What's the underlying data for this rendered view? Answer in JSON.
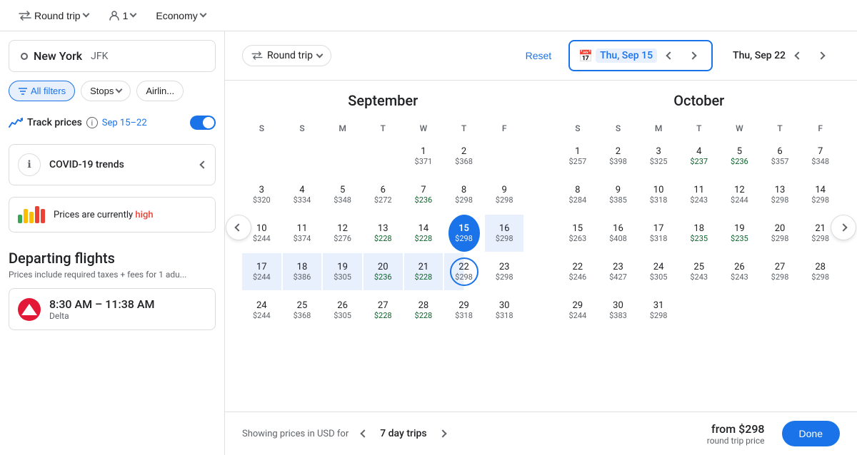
{
  "topbar": {
    "round_trip": "Round trip",
    "passengers": "1",
    "cabin": "Economy"
  },
  "sidebar": {
    "origin": "New York",
    "origin_code": "JFK",
    "filters": {
      "all_filters": "All filters",
      "stops": "Stops",
      "airlines": "Airlin..."
    },
    "track_prices": {
      "label": "Track prices",
      "date_range": "Sep 15–22"
    },
    "covid": {
      "label": "COVID-19 trends"
    },
    "prices_currently": {
      "label": "Prices are currently",
      "status": "high"
    },
    "departing": {
      "title": "Departing flights",
      "subtitle": "Prices include required taxes + fees for 1 adu...",
      "flight_time": "8:30 AM – 11:38 AM",
      "airline": "Delta"
    }
  },
  "calendar": {
    "header": {
      "round_trip": "Round trip",
      "reset": "Reset",
      "selected_date": "Thu, Sep 15",
      "return_date": "Thu, Sep 22"
    },
    "footer": {
      "showing_label": "Showing prices in USD for",
      "trips_duration": "7 day trips",
      "from_price": "from $298",
      "round_trip_price": "round trip price",
      "done": "Done"
    },
    "september": {
      "title": "September",
      "days_header": [
        "S",
        "S",
        "M",
        "T",
        "W",
        "T",
        "F"
      ],
      "weeks": [
        [
          {
            "num": "",
            "price": ""
          },
          {
            "num": "",
            "price": ""
          },
          {
            "num": "",
            "price": ""
          },
          {
            "num": "",
            "price": ""
          },
          {
            "num": "1",
            "price": "$371"
          },
          {
            "num": "2",
            "price": "$368"
          },
          {
            "num": "",
            "price": ""
          }
        ],
        [
          {
            "num": "3",
            "price": "$320"
          },
          {
            "num": "4",
            "price": "$334"
          },
          {
            "num": "5",
            "price": "$348"
          },
          {
            "num": "6",
            "price": "$272"
          },
          {
            "num": "7",
            "price": "$236",
            "green": true
          },
          {
            "num": "8",
            "price": "$298"
          },
          {
            "num": "9",
            "price": "$298"
          }
        ],
        [
          {
            "num": "10",
            "price": "$244"
          },
          {
            "num": "11",
            "price": "$374"
          },
          {
            "num": "12",
            "price": "$276"
          },
          {
            "num": "13",
            "price": "$228",
            "green": true
          },
          {
            "num": "14",
            "price": "$228",
            "green": true
          },
          {
            "num": "15",
            "price": "$298",
            "selected": true
          },
          {
            "num": "16",
            "price": "$298",
            "in_range": true
          }
        ],
        [
          {
            "num": "17",
            "price": "$244",
            "in_range": true
          },
          {
            "num": "18",
            "price": "$386",
            "in_range": true
          },
          {
            "num": "19",
            "price": "$305",
            "in_range": true
          },
          {
            "num": "20",
            "price": "$236",
            "green": true,
            "in_range": true
          },
          {
            "num": "21",
            "price": "$228",
            "green": true,
            "in_range": true
          },
          {
            "num": "22",
            "price": "$298",
            "range_end": true
          },
          {
            "num": "23",
            "price": "$298"
          }
        ],
        [
          {
            "num": "24",
            "price": "$244"
          },
          {
            "num": "25",
            "price": "$368"
          },
          {
            "num": "26",
            "price": "$305"
          },
          {
            "num": "27",
            "price": "$228",
            "green": true
          },
          {
            "num": "28",
            "price": "$228",
            "green": true
          },
          {
            "num": "29",
            "price": "$318"
          },
          {
            "num": "30",
            "price": "$318"
          }
        ]
      ]
    },
    "october": {
      "title": "October",
      "days_header": [
        "S",
        "S",
        "M",
        "T",
        "W",
        "T",
        "F"
      ],
      "weeks": [
        [
          {
            "num": "1",
            "price": "$257"
          },
          {
            "num": "2",
            "price": "$398"
          },
          {
            "num": "3",
            "price": "$325"
          },
          {
            "num": "4",
            "price": "$237",
            "green": true
          },
          {
            "num": "5",
            "price": "$236",
            "green": true
          },
          {
            "num": "6",
            "price": "$357"
          },
          {
            "num": "7",
            "price": "$348"
          }
        ],
        [
          {
            "num": "8",
            "price": "$284"
          },
          {
            "num": "9",
            "price": "$385"
          },
          {
            "num": "10",
            "price": "$318"
          },
          {
            "num": "11",
            "price": "$243"
          },
          {
            "num": "12",
            "price": "$244"
          },
          {
            "num": "13",
            "price": "$298"
          },
          {
            "num": "14",
            "price": "$298"
          }
        ],
        [
          {
            "num": "15",
            "price": "$263"
          },
          {
            "num": "16",
            "price": "$408"
          },
          {
            "num": "17",
            "price": "$318"
          },
          {
            "num": "18",
            "price": "$235",
            "green": true
          },
          {
            "num": "19",
            "price": "$235",
            "green": true
          },
          {
            "num": "20",
            "price": "$298"
          },
          {
            "num": "21",
            "price": "$298"
          }
        ],
        [
          {
            "num": "22",
            "price": "$246"
          },
          {
            "num": "23",
            "price": "$427"
          },
          {
            "num": "24",
            "price": "$305"
          },
          {
            "num": "25",
            "price": "$243"
          },
          {
            "num": "26",
            "price": "$243"
          },
          {
            "num": "27",
            "price": "$298"
          },
          {
            "num": "28",
            "price": "$298"
          }
        ],
        [
          {
            "num": "29",
            "price": "$244"
          },
          {
            "num": "30",
            "price": "$383"
          },
          {
            "num": "31",
            "price": "$298"
          },
          {
            "num": "",
            "price": ""
          },
          {
            "num": "",
            "price": ""
          },
          {
            "num": "",
            "price": ""
          },
          {
            "num": "",
            "price": ""
          }
        ]
      ]
    }
  }
}
